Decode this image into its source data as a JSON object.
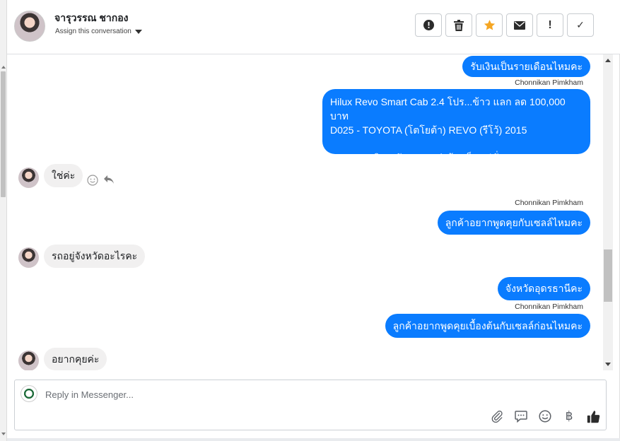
{
  "contact": {
    "name": "จารุวรรณ ชากอง",
    "assign_label": "Assign this conversation"
  },
  "actions": [
    {
      "name": "mark-spam-button",
      "icon": "alert-circle-icon"
    },
    {
      "name": "delete-button",
      "icon": "trash-icon"
    },
    {
      "name": "star-button",
      "icon": "star-icon",
      "color": "#f5a623"
    },
    {
      "name": "mark-unread-button",
      "icon": "envelope-icon"
    },
    {
      "name": "follow-up-button",
      "icon": "exclamation-icon",
      "glyph": "!"
    },
    {
      "name": "mark-done-button",
      "icon": "check-icon",
      "glyph": "✓"
    }
  ],
  "messages": {
    "m1": "รับเงินเป็นรายเดือนไหมคะ",
    "m1_sender": "Chonnikan Pimkham",
    "m2_line1": "Hilux Revo Smart Cab 2.4 โปร...ข้าว แลก ลด 100,000 บาท",
    "m2_line2": "D025 - TOYOTA (โตโยต้า) REVO (รีโว้) 2015",
    "m2_line3": "Option เสริม - ตัวยกสูงแต่งล้อแม็กแฟชั่น",
    "m3": "ใช่ค่ะ",
    "m4_sender": "Chonnikan Pimkham",
    "m4": "ลูกค้าอยากพูดคุยกับเซลล์ไหมคะ",
    "m5": "รถอยู่จังหวัดอะไรคะ",
    "m6": "จังหวัดอุดรธานีคะ",
    "m6_sender": "Chonnikan Pimkham",
    "m7": "ลูกค้าอยากพูดคุยเบื้องต้นกับเซลล์ก่อนไหมคะ",
    "m8": "อยากคุยค่ะ"
  },
  "reply": {
    "placeholder": "Reply in Messenger...",
    "tools": [
      "paperclip-icon",
      "saved-reply-icon",
      "emoji-icon",
      "baht-icon",
      "thumbs-up-icon"
    ],
    "baht_glyph": "฿"
  },
  "colors": {
    "outgoing_bubble": "#0a7cff",
    "incoming_bubble": "#f1f0f0",
    "star": "#f5a623"
  }
}
